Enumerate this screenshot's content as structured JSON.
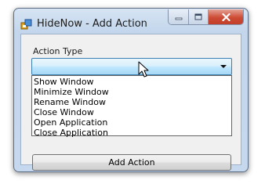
{
  "window": {
    "title": "HideNow - Add Action",
    "icon": "app-icon",
    "controls": [
      "minimize-icon",
      "maximize-icon",
      "close-icon"
    ]
  },
  "form": {
    "action_type_label": "Action Type",
    "action_type_value": "",
    "options": [
      "Show Window",
      "Minimize Window",
      "Rename Window",
      "Close Window",
      "Open Application",
      "Close Application"
    ],
    "add_button_label": "Add Action"
  },
  "colors": {
    "combo_border": "#3c7fb1",
    "combo_fill": "#bee6fd",
    "close_button": "#c84530",
    "window_frame": "#c4d6ec",
    "client_bg": "#f0f0f0"
  }
}
